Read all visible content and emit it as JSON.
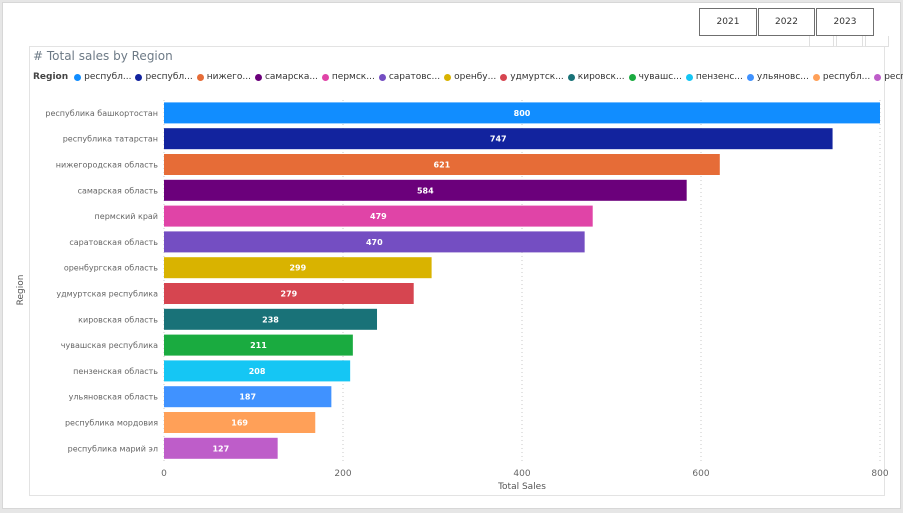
{
  "filters": {
    "years": [
      "2021",
      "2022",
      "2023"
    ]
  },
  "legend": {
    "title": "Region",
    "entries": [
      {
        "label": "республ...",
        "color": "#118DFF"
      },
      {
        "label": "республ...",
        "color": "#12239E"
      },
      {
        "label": "нижего...",
        "color": "#E66C37"
      },
      {
        "label": "самарска...",
        "color": "#6B007B"
      },
      {
        "label": "пермск...",
        "color": "#E044A7"
      },
      {
        "label": "саратовс...",
        "color": "#744EC2"
      },
      {
        "label": "оренбу...",
        "color": "#D9B300"
      },
      {
        "label": "удмуртск...",
        "color": "#D64550"
      },
      {
        "label": "кировск...",
        "color": "#197278"
      },
      {
        "label": "чувашс...",
        "color": "#1AAB40"
      },
      {
        "label": "пензенс...",
        "color": "#15C6F4"
      },
      {
        "label": "ульяновс...",
        "color": "#4092FF"
      },
      {
        "label": "республ...",
        "color": "#FFA058"
      },
      {
        "label": "республ...",
        "color": "#BE5DC9"
      }
    ]
  },
  "chart_data": {
    "type": "bar",
    "orientation": "horizontal",
    "title": "# Total sales by Region",
    "xlabel": "Total Sales",
    "ylabel": "Region",
    "xlim": [
      0,
      800
    ],
    "xticks": [
      0,
      200,
      400,
      600,
      800
    ],
    "grid": true,
    "categories": [
      "республика башкортостан",
      "республика татарстан",
      "нижегородская область",
      "самарская область",
      "пермский край",
      "саратовская область",
      "оренбургская область",
      "удмуртская республика",
      "кировская область",
      "чувашская республика",
      "пензенская область",
      "ульяновская область",
      "республика мордовия",
      "республика марий эл"
    ],
    "values": [
      800,
      747,
      621,
      584,
      479,
      470,
      299,
      279,
      238,
      211,
      208,
      187,
      169,
      127
    ],
    "colors": [
      "#118DFF",
      "#12239E",
      "#E66C37",
      "#6B007B",
      "#E044A7",
      "#744EC2",
      "#D9B300",
      "#D64550",
      "#197278",
      "#1AAB40",
      "#15C6F4",
      "#4092FF",
      "#FFA058",
      "#BE5DC9"
    ]
  }
}
